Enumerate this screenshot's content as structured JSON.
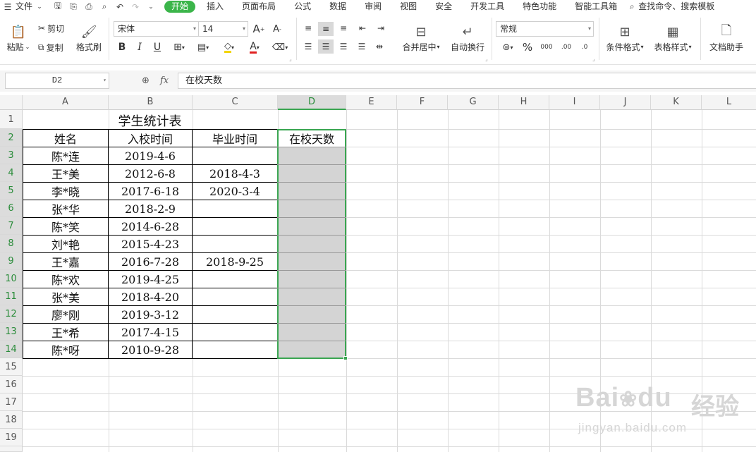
{
  "menu": {
    "file": "文件",
    "tabs": [
      "开始",
      "插入",
      "页面布局",
      "公式",
      "数据",
      "审阅",
      "视图",
      "安全",
      "开发工具",
      "特色功能",
      "智能工具箱"
    ],
    "active_tab": "开始",
    "search": "查找命令、搜索模板"
  },
  "ribbon": {
    "paste": "粘贴",
    "cut": "剪切",
    "copy": "复制",
    "format_painter": "格式刷",
    "font_name": "宋体",
    "font_size": "14",
    "bold": "B",
    "italic": "I",
    "underline": "U",
    "font_color_glyph": "A",
    "merge_center": "合并居中",
    "wrap_text": "自动换行",
    "number_format": "常规",
    "percent": "%",
    "thousands": "000",
    "inc_decimal": ".00",
    "dec_decimal": ".0",
    "conditional_format": "条件格式",
    "table_style": "表格样式",
    "doc_helper": "文档助手"
  },
  "formula_bar": {
    "name_box": "D2",
    "fx": "fx",
    "content": "在校天数"
  },
  "columns": [
    "A",
    "B",
    "C",
    "D",
    "E",
    "F",
    "G",
    "H",
    "I",
    "J",
    "K",
    "L"
  ],
  "rows": [
    "1",
    "2",
    "3",
    "4",
    "5",
    "6",
    "7",
    "8",
    "9",
    "10",
    "11",
    "12",
    "13",
    "14",
    "15",
    "16",
    "17",
    "18",
    "19"
  ],
  "active_cell": "D2",
  "sheet": {
    "title": "学生统计表",
    "headers": [
      "姓名",
      "入校时间",
      "毕业时间",
      "在校天数"
    ],
    "records": [
      [
        "陈*连",
        "2019-4-6",
        "",
        ""
      ],
      [
        "王*美",
        "2012-6-8",
        "2018-4-3",
        ""
      ],
      [
        "李*晓",
        "2017-6-18",
        "2020-3-4",
        ""
      ],
      [
        "张*华",
        "2018-2-9",
        "",
        ""
      ],
      [
        "陈*笑",
        "2014-6-28",
        "",
        ""
      ],
      [
        "刘*艳",
        "2015-4-23",
        "",
        ""
      ],
      [
        "王*嘉",
        "2016-7-28",
        "2018-9-25",
        ""
      ],
      [
        "陈*欢",
        "2019-4-25",
        "",
        ""
      ],
      [
        "张*美",
        "2018-4-20",
        "",
        ""
      ],
      [
        "廖*刚",
        "2019-3-12",
        "",
        ""
      ],
      [
        "王*希",
        "2017-4-15",
        "",
        ""
      ],
      [
        "陈*呀",
        "2010-9-28",
        "",
        ""
      ]
    ]
  },
  "watermark": {
    "brand": "Bai",
    "brand2": "du",
    "cn": "经验",
    "url": "jingyan.baidu.com"
  }
}
